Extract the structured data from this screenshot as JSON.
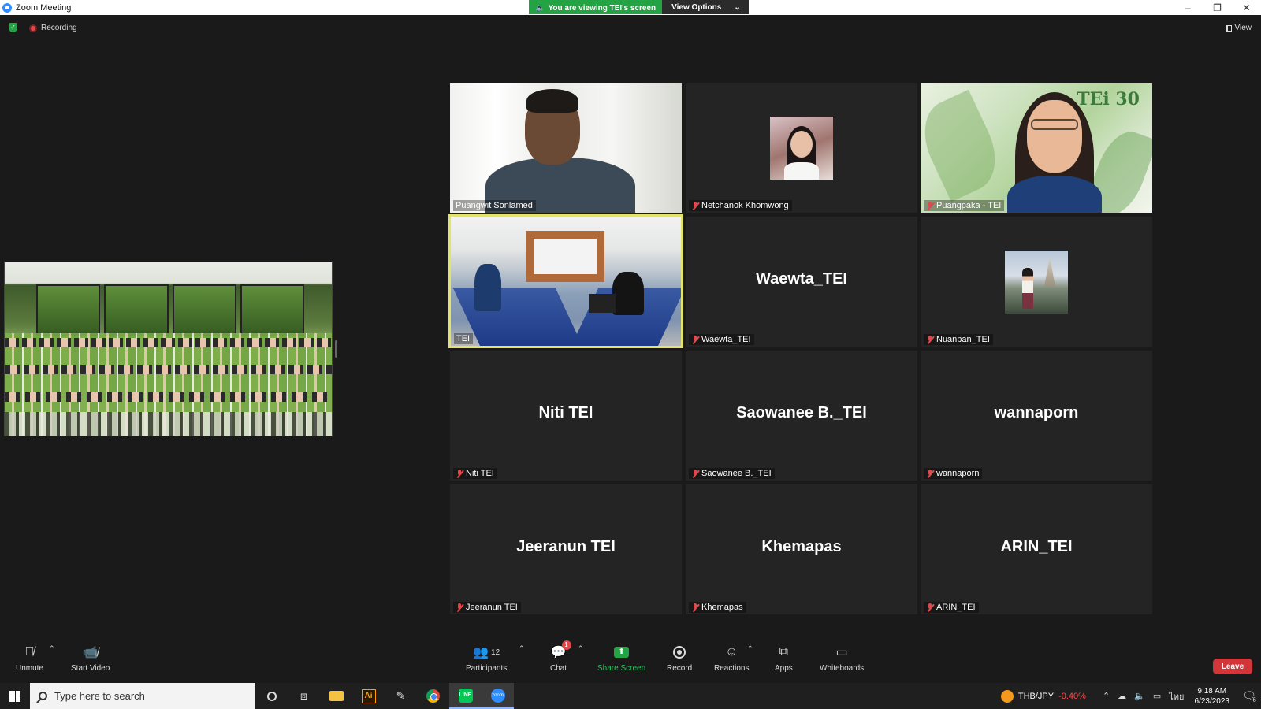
{
  "window": {
    "title": "Zoom Meeting",
    "viewing_banner": "You are viewing TEI's screen",
    "view_options": "View Options",
    "controls": [
      "–",
      "❐",
      "✕"
    ]
  },
  "meeting_bar": {
    "recording_label": "Recording",
    "view_label": "View"
  },
  "participants": [
    {
      "display_name": "Puangwit Sonlamed",
      "label": "Puangwit Sonlamed",
      "muted": false,
      "video": "camera"
    },
    {
      "display_name": "Netchanok Khomwong",
      "label": "Netchanok Khomwong",
      "muted": true,
      "video": "avatar"
    },
    {
      "display_name": "Puangpaka - TEI",
      "label": "Puangpaka - TEI",
      "muted": true,
      "video": "camera"
    },
    {
      "display_name": "TEI",
      "label": "TEI",
      "muted": false,
      "video": "camera",
      "active_speaker": true
    },
    {
      "display_name": "Waewta_TEI",
      "label": "Waewta_TEI",
      "muted": true,
      "video": "off"
    },
    {
      "display_name": "Nuanpan_TEI",
      "label": "Nuanpan_TEI",
      "muted": true,
      "video": "avatar"
    },
    {
      "display_name": "Niti TEI",
      "label": "Niti TEI",
      "muted": true,
      "video": "off"
    },
    {
      "display_name": "Saowanee B._TEI",
      "label": "Saowanee B._TEI",
      "muted": true,
      "video": "off"
    },
    {
      "display_name": "wannaporn",
      "label": "wannaporn",
      "muted": true,
      "video": "off"
    },
    {
      "display_name": "Jeeranun TEI",
      "label": "Jeeranun TEI",
      "muted": true,
      "video": "off"
    },
    {
      "display_name": "Khemapas",
      "label": "Khemapas",
      "muted": true,
      "video": "off"
    },
    {
      "display_name": "ARIN_TEI",
      "label": "ARIN_TEI",
      "muted": true,
      "video": "off"
    }
  ],
  "shared_screen_logo": "TEi 30",
  "toolbar": {
    "unmute": "Unmute",
    "start_video": "Start Video",
    "participants": "Participants",
    "participants_count": "12",
    "chat": "Chat",
    "chat_badge": "1",
    "share_screen": "Share Screen",
    "record": "Record",
    "reactions": "Reactions",
    "apps": "Apps",
    "whiteboards": "Whiteboards",
    "leave": "Leave"
  },
  "taskbar": {
    "search_placeholder": "Type here to search",
    "currency_pair": "THB/JPY",
    "currency_change": "-0.40%",
    "language": "ไทย",
    "time": "9:18 AM",
    "date": "6/23/2023",
    "notification_count": "6"
  },
  "colors": {
    "accent_green": "#23a343",
    "muted_red": "#e0484b",
    "active_speaker_border": "#e3e26b",
    "leave_red": "#d3363a",
    "zoom_blue": "#2d8cff"
  }
}
